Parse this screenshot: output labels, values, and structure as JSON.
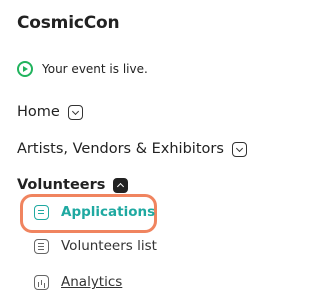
{
  "app": {
    "title": "CosmicCon"
  },
  "status": {
    "text": "Your event is live.",
    "icon": "play-circle-icon",
    "color": "#21b35d"
  },
  "nav": {
    "home": {
      "label": "Home",
      "icon": "chevron-down-icon"
    },
    "artists": {
      "label": "Artists, Vendors & Exhibitors",
      "icon": "chevron-down-icon"
    },
    "volunteers": {
      "label": "Volunteers",
      "icon": "chevron-up-icon",
      "expanded": true,
      "items": [
        {
          "label": "Applications",
          "icon": "document-icon",
          "active": true
        },
        {
          "label": "Volunteers list",
          "icon": "list-icon",
          "active": false
        },
        {
          "label": "Analytics",
          "icon": "chart-icon",
          "active": false
        }
      ]
    }
  },
  "colors": {
    "accent": "#1fa9a1",
    "highlight": "#f0845f"
  }
}
